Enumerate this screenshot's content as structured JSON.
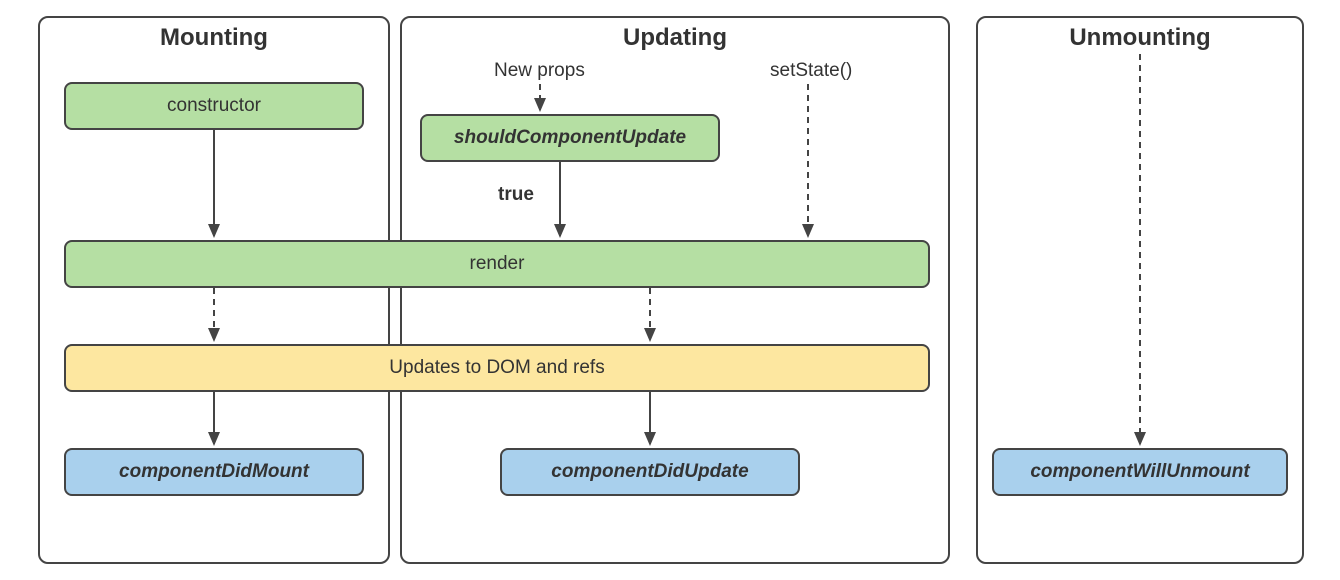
{
  "panels": {
    "mounting": {
      "title": "Mounting"
    },
    "updating": {
      "title": "Updating"
    },
    "unmounting": {
      "title": "Unmounting"
    }
  },
  "boxes": {
    "constructor": "constructor",
    "shouldComponentUpdate": "shouldComponentUpdate",
    "render": "render",
    "updatesDom": "Updates to DOM and refs",
    "componentDidMount": "componentDidMount",
    "componentDidUpdate": "componentDidUpdate",
    "componentWillUnmount": "componentWillUnmount"
  },
  "labels": {
    "newProps": "New props",
    "setState": "setState()",
    "true": "true"
  },
  "colors": {
    "green": "#b5dfa3",
    "yellow": "#fde7a0",
    "blue": "#a9d0ed",
    "border": "#444444"
  }
}
